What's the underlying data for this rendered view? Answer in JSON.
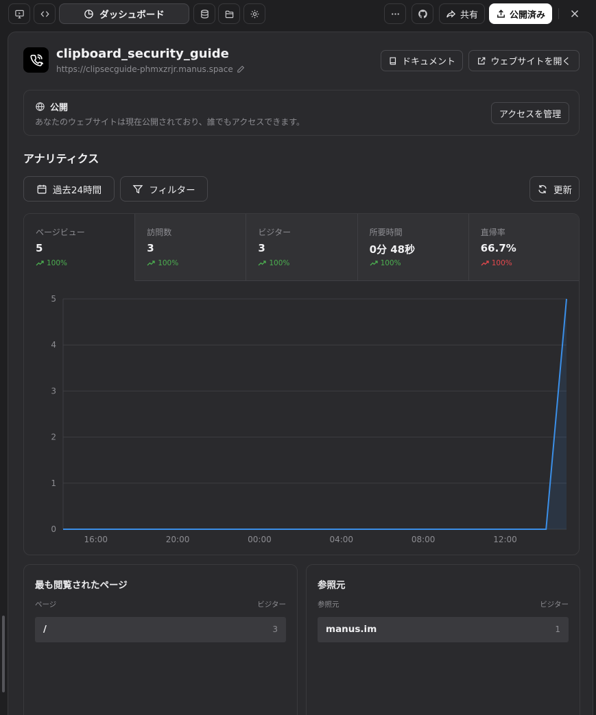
{
  "toolbar": {
    "dashboard_label": "ダッシュボード",
    "share_label": "共有",
    "publish_label": "公開済み"
  },
  "project": {
    "name": "clipboard_security_guide",
    "url": "https://clipsecguide-phmxzrjr.manus.space",
    "docs_label": "ドキュメント",
    "open_site_label": "ウェブサイトを開く"
  },
  "visibility": {
    "title": "公開",
    "description": "あなたのウェブサイトは現在公開されており、誰でもアクセスできます。",
    "manage_label": "アクセスを管理"
  },
  "analytics": {
    "heading": "アナリティクス",
    "range_label": "過去24時間",
    "filter_label": "フィルター",
    "refresh_label": "更新",
    "stats": [
      {
        "label": "ページビュー",
        "value": "5",
        "delta": "100%",
        "trend": "up",
        "color": "#4caf50"
      },
      {
        "label": "訪問数",
        "value": "3",
        "delta": "100%",
        "trend": "up",
        "color": "#4caf50"
      },
      {
        "label": "ビジター",
        "value": "3",
        "delta": "100%",
        "trend": "up",
        "color": "#4caf50"
      },
      {
        "label": "所要時間",
        "value": "0分 48秒",
        "delta": "100%",
        "trend": "up",
        "color": "#4caf50"
      },
      {
        "label": "直帰率",
        "value": "66.7%",
        "delta": "100%",
        "trend": "up",
        "color": "#e5484d"
      }
    ]
  },
  "chart_data": {
    "type": "area",
    "x": [
      0,
      1,
      2,
      3,
      4,
      5,
      6,
      7,
      8,
      9,
      10,
      11,
      12,
      13,
      14,
      15,
      16,
      17,
      18,
      19,
      20,
      21,
      22,
      23
    ],
    "x_tick_labels": [
      "16:00",
      "20:00",
      "00:00",
      "04:00",
      "08:00",
      "12:00"
    ],
    "series": [
      {
        "values": [
          0,
          0,
          0,
          0,
          0,
          0,
          0,
          0,
          0,
          0,
          0,
          0,
          0,
          0,
          0,
          0,
          0,
          0,
          0,
          0,
          0,
          0,
          0,
          5
        ]
      }
    ],
    "ylim": [
      0,
      5
    ],
    "y_ticks": [
      0,
      1,
      2,
      3,
      4,
      5
    ],
    "grid": true,
    "line_color": "#3b8fe8"
  },
  "top_pages": {
    "title": "最も閲覧されたページ",
    "col_key": "ページ",
    "col_value": "ビジター",
    "rows": [
      {
        "key": "/",
        "value": "3"
      }
    ]
  },
  "referrers": {
    "title": "参照元",
    "col_key": "参照元",
    "col_value": "ビジター",
    "rows": [
      {
        "key": "manus.im",
        "value": "1"
      }
    ]
  }
}
